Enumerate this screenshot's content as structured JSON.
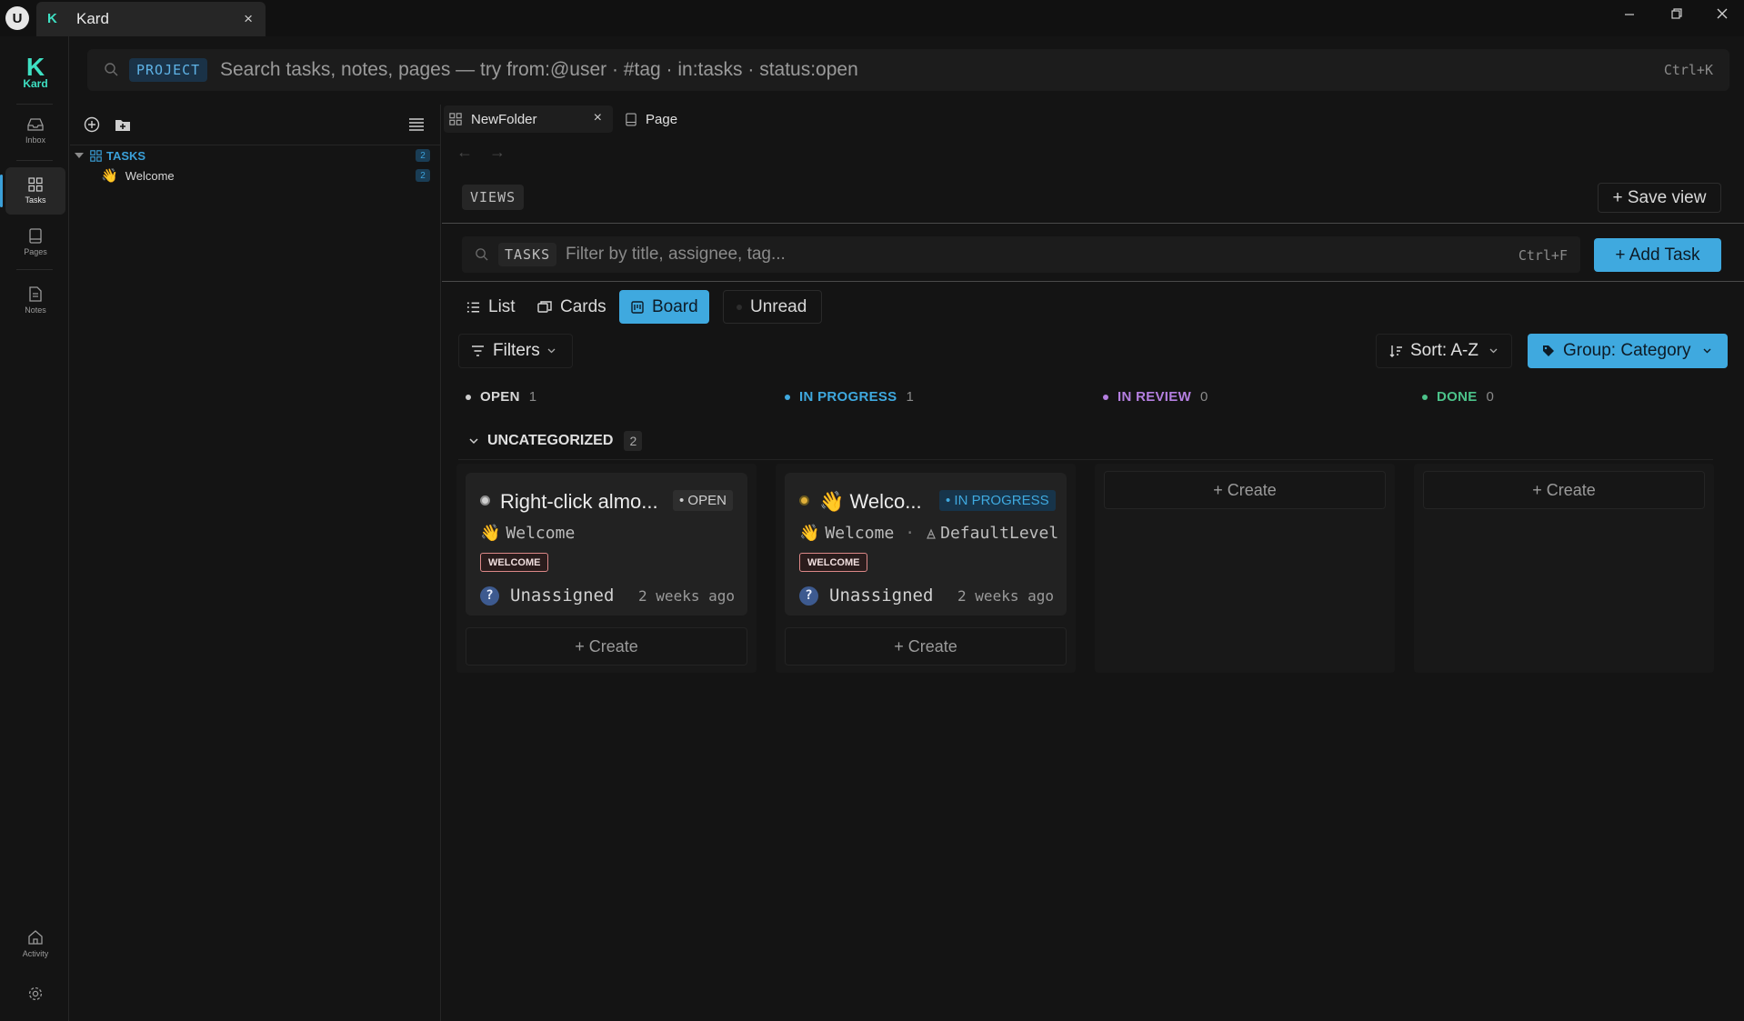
{
  "window": {
    "app_logo": "U",
    "tab_title": "Kard",
    "tab_logo": "K",
    "close_glyph": "×",
    "controls": {
      "minimize": "–",
      "restore": "⧉",
      "close": "✕"
    }
  },
  "rail": {
    "logo_letter": "K",
    "logo_word": "Kard",
    "items": [
      {
        "label": "Inbox",
        "icon": "inbox-icon"
      },
      {
        "label": "Tasks",
        "icon": "grid-icon",
        "active": true
      },
      {
        "label": "Pages",
        "icon": "page-icon"
      },
      {
        "label": "Notes",
        "icon": "note-icon"
      }
    ],
    "bottom": [
      {
        "label": "Activity",
        "icon": "home-icon"
      },
      {
        "label": "",
        "icon": "gear-icon"
      }
    ]
  },
  "search": {
    "scope": "PROJECT",
    "placeholder": "Search tasks, notes, pages — try from:@user · #tag · in:tasks · status:open",
    "shortcut": "Ctrl+K"
  },
  "sidebar": {
    "tree": [
      {
        "label": "TASKS",
        "count": "2",
        "emoji": "",
        "color": "#3ba0d9"
      },
      {
        "label": "Welcome",
        "count": "2",
        "emoji": "👋",
        "color": "#d6d6d6"
      }
    ]
  },
  "doc_tabs": [
    {
      "label": "NewFolder",
      "icon": "grid-icon",
      "active": true,
      "closable": "×"
    },
    {
      "label": "Page",
      "icon": "page-icon",
      "active": false
    }
  ],
  "nav": {
    "back": "←",
    "forward": "→"
  },
  "views": {
    "label": "VIEWS",
    "save_view": "+ Save view"
  },
  "filter": {
    "scope": "TASKS",
    "placeholder": "Filter by title, assignee, tag...",
    "shortcut": "Ctrl+F",
    "add_task": "+ Add Task"
  },
  "view_modes": [
    {
      "label": "List",
      "icon": "list-icon"
    },
    {
      "label": "Cards",
      "icon": "cards-icon"
    },
    {
      "label": "Board",
      "icon": "board-icon",
      "active": true
    },
    {
      "label": "Unread",
      "icon": "dot-icon"
    }
  ],
  "toolbar": {
    "filters": "Filters",
    "sort": "Sort: A-Z",
    "group": "Group: Category",
    "chevron": "⌄"
  },
  "columns": [
    {
      "label": "OPEN",
      "count": "1",
      "color": "#cfcfcf"
    },
    {
      "label": "IN PROGRESS",
      "count": "1",
      "color": "#3fa9df"
    },
    {
      "label": "IN REVIEW",
      "count": "0",
      "color": "#b47fe0"
    },
    {
      "label": "DONE",
      "count": "0",
      "color": "#4cc38a"
    }
  ],
  "group": {
    "label": "UNCATEGORIZED",
    "count": "2",
    "chevron": "⌄"
  },
  "cards": [
    {
      "title": "Right-click almo...",
      "badge": "• OPEN",
      "badge_color": "#cfcfcf",
      "meta_emoji": "👋",
      "meta": "Welcome",
      "level": "",
      "tag": "WELCOME",
      "assignee": "Unassigned",
      "avatar": "?",
      "time": "2 weeks ago"
    },
    {
      "title": "👋 Welco...",
      "badge": "• IN PROGRESS",
      "badge_color": "#3fa9df",
      "meta_emoji": "👋",
      "meta": "Welcome",
      "level": "DefaultLevel",
      "tag": "WELCOME",
      "assignee": "Unassigned",
      "avatar": "?",
      "time": "2 weeks ago"
    }
  ],
  "create_label": "+ Create",
  "colors": {
    "accent": "#3fa9df",
    "brand": "#3ee0c3",
    "background": "#141414"
  }
}
